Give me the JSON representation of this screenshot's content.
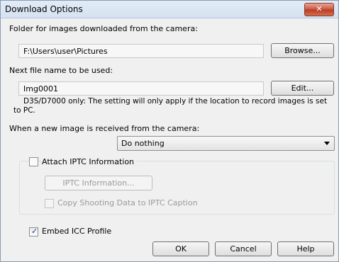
{
  "window": {
    "title": "Download Options",
    "close_label": "✕"
  },
  "folder": {
    "label": "Folder for images downloaded from the camera:",
    "value": "F:\\Users\\user\\Pictures",
    "browse_label": "Browse..."
  },
  "next_file": {
    "label": "Next file name to be used:",
    "value": "Img0001",
    "edit_label": "Edit...",
    "note_line1": "D3S/D7000 only: The setting will only apply if the location to record images is set",
    "note_line2": "to PC."
  },
  "new_image": {
    "label": "When a new image is received from the camera:",
    "selected": "Do nothing"
  },
  "iptc": {
    "attach_label": "Attach IPTC Information",
    "attach_checked": false,
    "info_button": "IPTC Information...",
    "copy_label": "Copy Shooting Data to IPTC Caption",
    "copy_checked": false
  },
  "icc": {
    "label": "Embed ICC Profile",
    "checked": true
  },
  "footer": {
    "ok": "OK",
    "cancel": "Cancel",
    "help": "Help"
  }
}
